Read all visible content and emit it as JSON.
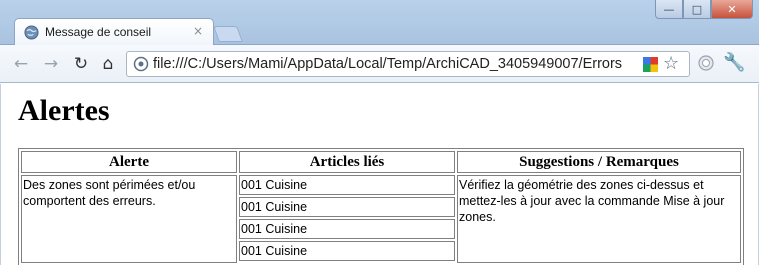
{
  "browser": {
    "tab_title": "Message de conseil",
    "tab_close": "×",
    "url": "file:///C:/Users/Mami/AppData/Local/Temp/ArchiCAD_3405949007/Errors",
    "window_controls": {
      "minimize": "—",
      "maximize": "□",
      "close": "✕"
    },
    "nav": {
      "back": "←",
      "forward": "→",
      "reload": "↻",
      "home": "⌂"
    },
    "star": "☆",
    "wrench": "🔧"
  },
  "page": {
    "heading": "Alertes",
    "table": {
      "headers": [
        "Alerte",
        "Articles liés",
        "Suggestions / Remarques"
      ],
      "rows": [
        {
          "alert": "Des zones sont périmées et/ou comportent des erreurs.",
          "items": [
            "001 Cuisine",
            "001 Cuisine",
            "001 Cuisine",
            "001 Cuisine"
          ],
          "suggestion": "Vérifiez la géométrie des zones ci-dessus et mettez-les à jour avec la commande Mise à jour zones."
        }
      ]
    }
  }
}
